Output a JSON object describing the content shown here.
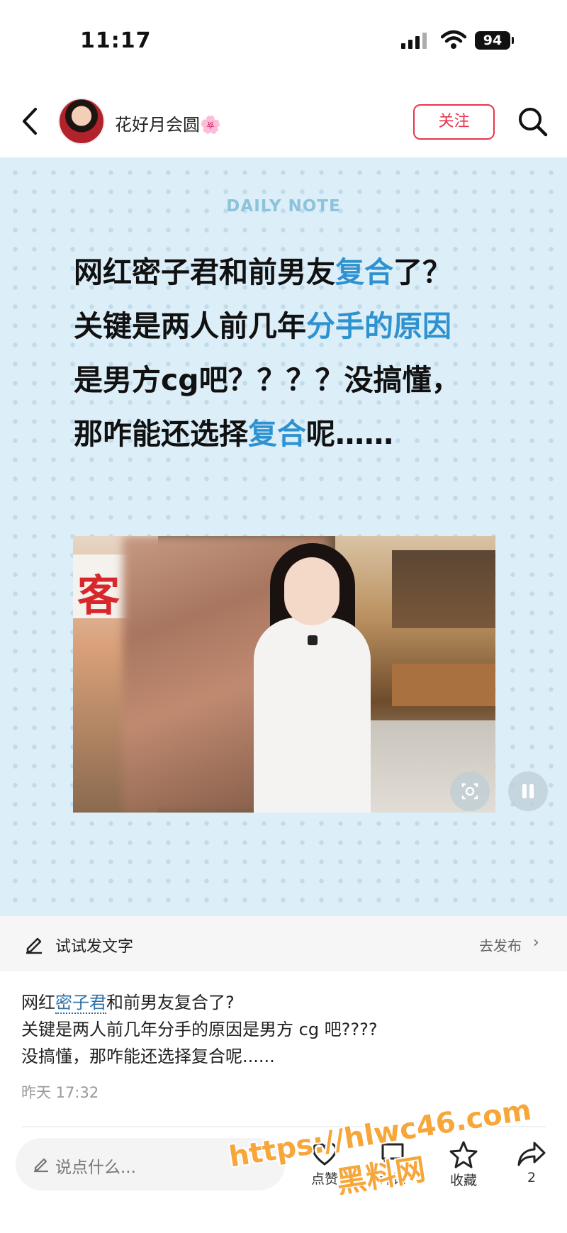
{
  "status_bar": {
    "time": "11:17",
    "battery": "94"
  },
  "header": {
    "author_name": "花好月会圆",
    "author_emoji": "🌸",
    "follow_label": "关注"
  },
  "post_image": {
    "top_label": "DAILY NOTE",
    "headline_segments": [
      {
        "text": "网红密子君和前男友",
        "highlight": false
      },
      {
        "text": "复合",
        "highlight": true
      },
      {
        "text": "了？关键是两人前几年",
        "highlight": false
      },
      {
        "text": "分手的原因",
        "highlight": true
      },
      {
        "text": "是男方cg吧？？？？没搞懂，那咋能还选择",
        "highlight": false
      },
      {
        "text": "复合",
        "highlight": true
      },
      {
        "text": "呢……",
        "highlight": false
      }
    ],
    "photo_sign_text": "客",
    "accent_color": "#2e92d0"
  },
  "try_bar": {
    "label": "试试发文字",
    "publish_label": "去发布",
    "arrow": "›"
  },
  "post_body": {
    "line1_prefix": "网红",
    "line1_tag": "密子君",
    "line1_suffix": "和前男友复合了?",
    "line2": "关键是两人前几年分手的原因是男方 cg 吧????",
    "line3": "没搞懂，那咋能还选择复合呢......",
    "time": "昨天 17:32"
  },
  "bottom_bar": {
    "comment_placeholder": "说点什么...",
    "like_label": "点赞",
    "comment_label": "评论",
    "collect_label": "收藏",
    "share_count": "2"
  },
  "watermark": {
    "url": "https://hlwc46.com",
    "name": "黑料网"
  }
}
